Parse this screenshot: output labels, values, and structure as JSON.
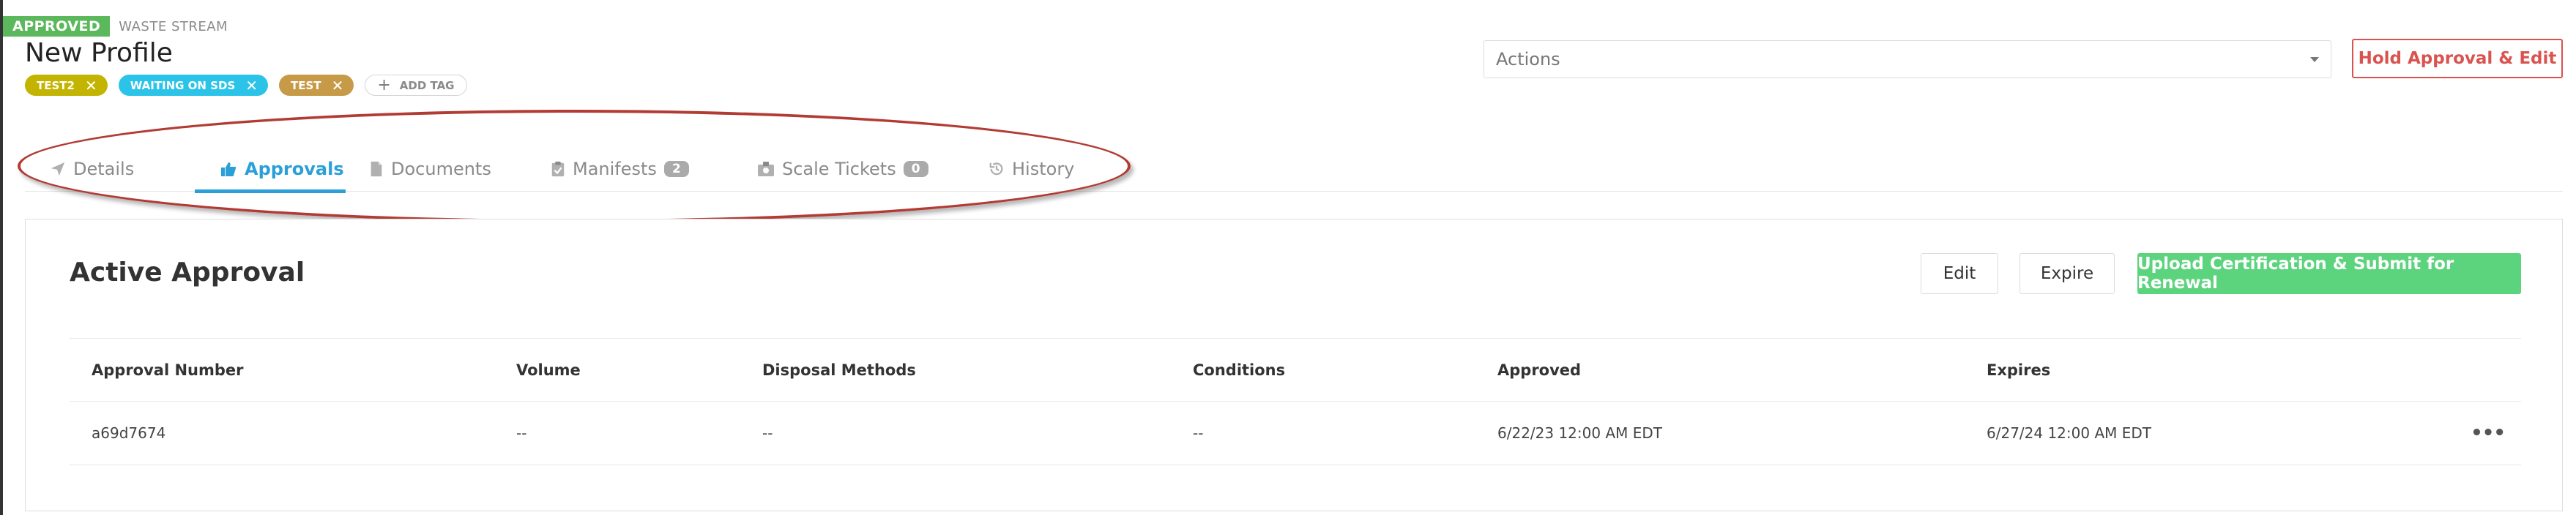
{
  "header": {
    "status": "APPROVED",
    "stream_label": "WASTE STREAM",
    "title": "New Profile",
    "tags": [
      {
        "label": "TEST2",
        "color": "#c2b400"
      },
      {
        "label": "WAITING ON SDS",
        "color": "#2cc3e8"
      },
      {
        "label": "TEST",
        "color": "#c79a47"
      }
    ],
    "add_tag_label": "ADD TAG",
    "actions_placeholder": "Actions",
    "hold_button": "Hold Approval & Edit"
  },
  "tabs": [
    {
      "label": "Details",
      "icon": "paper-plane-icon"
    },
    {
      "label": "Approvals",
      "icon": "thumbs-up-icon",
      "active": true
    },
    {
      "label": "Documents",
      "icon": "file-icon"
    },
    {
      "label": "Manifests",
      "icon": "clipboard-check-icon",
      "count": "2"
    },
    {
      "label": "Scale Tickets",
      "icon": "ticket-icon",
      "count": "0"
    },
    {
      "label": "History",
      "icon": "history-icon"
    }
  ],
  "approval": {
    "title": "Active Approval",
    "edit_button": "Edit",
    "expire_button": "Expire",
    "upload_button": "Upload Certification & Submit for Renewal",
    "columns": [
      "Approval Number",
      "Volume",
      "Disposal Methods",
      "Conditions",
      "Approved",
      "Expires"
    ],
    "rows": [
      [
        "a69d7674",
        "--",
        "--",
        "--",
        "6/22/23 12:00 AM EDT",
        "6/27/24 12:00 AM EDT"
      ]
    ],
    "row_menu_label": "•••"
  },
  "colors": {
    "approved": "#5cb85c",
    "accent": "#2a9fd8",
    "danger": "#d9534f",
    "success_button": "#5cd37d",
    "annotation": "#b23b34"
  }
}
